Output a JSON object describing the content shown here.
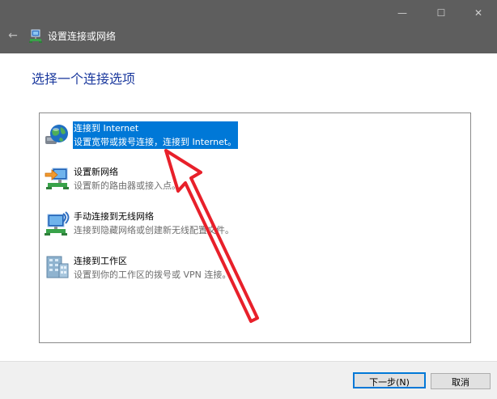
{
  "window": {
    "title": "设置连接或网络",
    "minimize_glyph": "—",
    "maximize_glyph": "☐",
    "close_glyph": "✕",
    "back_glyph": "←"
  },
  "heading": "选择一个连接选项",
  "options": [
    {
      "title": "连接到 Internet",
      "description": "设置宽带或拨号连接，连接到 Internet。",
      "icon": "globe-internet-icon",
      "selected": true
    },
    {
      "title": "设置新网络",
      "description": "设置新的路由器或接入点。",
      "icon": "new-network-router-icon",
      "selected": false
    },
    {
      "title": "手动连接到无线网络",
      "description": "连接到隐藏网络或创建新无线配置文件。",
      "icon": "wireless-network-icon",
      "selected": false
    },
    {
      "title": "连接到工作区",
      "description": "设置到你的工作区的拨号或 VPN 连接。",
      "icon": "workplace-vpn-icon",
      "selected": false
    }
  ],
  "buttons": {
    "next": "下一步(N)",
    "cancel": "取消"
  },
  "colors": {
    "titlebar": "#5e5e5e",
    "selection": "#0078d7",
    "heading": "#1c3a9e",
    "annotation_arrow": "#e8202a"
  }
}
